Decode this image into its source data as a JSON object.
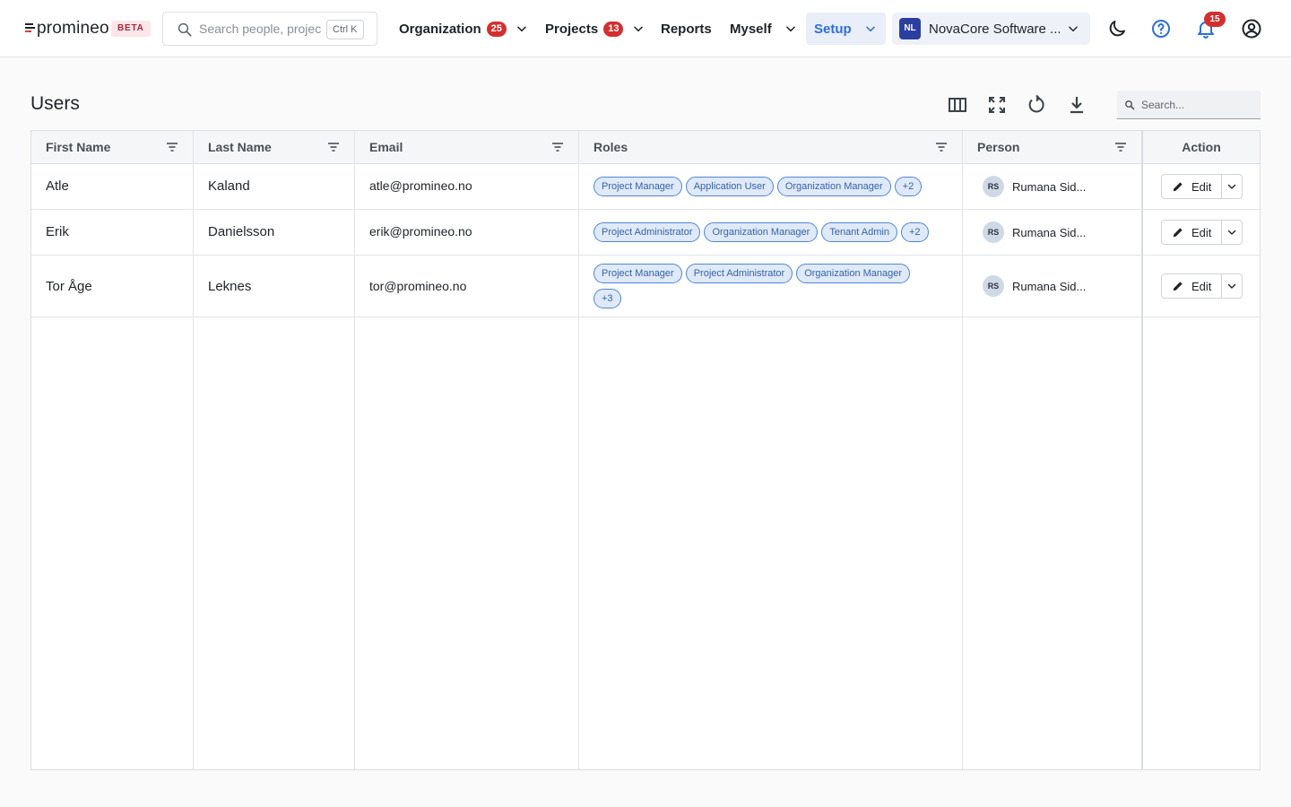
{
  "header": {
    "logo_text": "promineo",
    "beta_label": "BETA",
    "search": {
      "placeholder": "Search people, projects...",
      "shortcut": "Ctrl K"
    },
    "nav": {
      "organization": {
        "label": "Organization",
        "count": "25"
      },
      "projects": {
        "label": "Projects",
        "count": "13"
      },
      "reports": {
        "label": "Reports"
      },
      "myself": {
        "label": "Myself"
      },
      "setup": {
        "label": "Setup"
      }
    },
    "org_selector": {
      "initials": "NL",
      "name": "NovaCore Software ..."
    },
    "notifications_count": "15",
    "icons": [
      "moon-icon",
      "help-icon",
      "bell-icon",
      "user-circle-icon"
    ]
  },
  "page": {
    "title": "Users",
    "toolbar_icons": [
      "columns-icon",
      "fullscreen-icon",
      "refresh-icon",
      "download-icon"
    ],
    "search_placeholder": "Search..."
  },
  "table": {
    "columns": [
      "First Name",
      "Last Name",
      "Email",
      "Roles",
      "Person",
      "Action"
    ],
    "rows": [
      {
        "first_name": "Atle",
        "last_name": "Kaland",
        "email": "atle@promineo.no",
        "roles": [
          "Project Manager",
          "Application User",
          "Organization Manager",
          "+2"
        ],
        "person_initials": "RS",
        "person_name": "Rumana Sid...",
        "action_label": "Edit"
      },
      {
        "first_name": "Erik",
        "last_name": "Danielsson",
        "email": "erik@promineo.no",
        "roles": [
          "Project Administrator",
          "Organization Manager",
          "Tenant Admin",
          "+2"
        ],
        "person_initials": "RS",
        "person_name": "Rumana Sid...",
        "action_label": "Edit"
      },
      {
        "first_name": "Tor Åge",
        "last_name": "Leknes",
        "email": "tor@promineo.no",
        "roles": [
          "Project Manager",
          "Project Administrator",
          "Organization Manager",
          "+3"
        ],
        "person_initials": "RS",
        "person_name": "Rumana Sid...",
        "action_label": "Edit"
      }
    ]
  },
  "colors": {
    "accent": "#2f6fd6",
    "badge": "#d32f2f",
    "chip_bg": "#dfe9f8",
    "chip_border": "#4f86d8"
  }
}
